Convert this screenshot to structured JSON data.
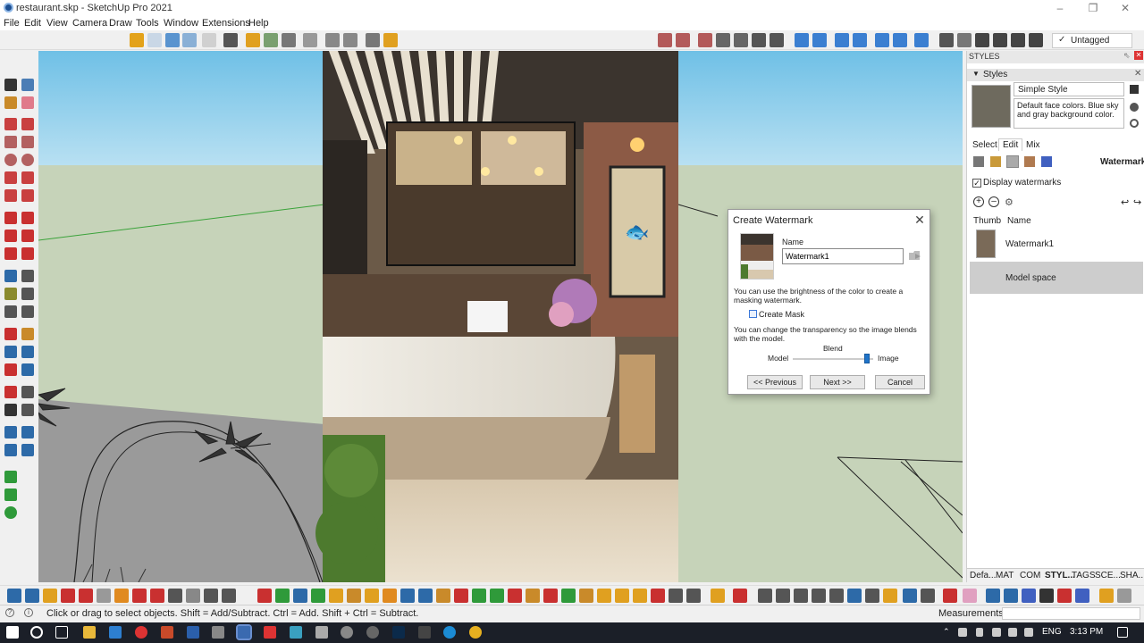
{
  "window": {
    "title": "restaurant.skp - SketchUp Pro 2021"
  },
  "menu": [
    "File",
    "Edit",
    "View",
    "Camera",
    "Draw",
    "Tools",
    "Window",
    "Extensions",
    "Help"
  ],
  "toolbar": {
    "tag_selector": "Untagged"
  },
  "styles_panel": {
    "header": "STYLES",
    "tray_label": "Styles",
    "style_name": "Simple Style",
    "style_description": "Default face colors. Blue sky and gray background color.",
    "tabs": [
      "Select",
      "Edit",
      "Mix"
    ],
    "section_label": "Watermark",
    "display_watermarks_label": "Display watermarks",
    "columns": [
      "Thumb",
      "Name"
    ],
    "rows": [
      {
        "name": "Watermark1"
      },
      {
        "name": "Model space"
      }
    ],
    "bottom_tabs": [
      "Defa...",
      "MAT",
      "COM",
      "STYL...",
      "TAGS",
      "SCE...",
      "SHA..."
    ]
  },
  "dialog": {
    "title": "Create Watermark",
    "name_label": "Name",
    "name_value": "Watermark1",
    "text_brightness": "You can use the brightness of the color to create a masking watermark.",
    "mask_label": "Create Mask",
    "text_transparency": "You can change the transparency so the image blends with the  model.",
    "blend_label": "Blend",
    "model_label": "Model",
    "image_label": "Image",
    "blend_value": 0.95,
    "btn_previous": "<< Previous",
    "btn_next": "Next >>",
    "btn_cancel": "Cancel"
  },
  "status": {
    "text": "Click or drag to select objects. Shift = Add/Subtract. Ctrl = Add. Shift + Ctrl = Subtract.",
    "measurements_label": "Measurements"
  },
  "taskbar": {
    "language": "ENG",
    "time": "3:13 PM"
  }
}
